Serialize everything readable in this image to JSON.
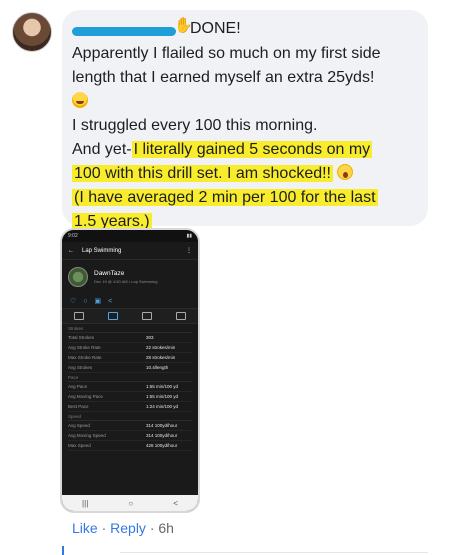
{
  "comment": {
    "tag": "DONE!",
    "lines": [
      "Apparently I flailed so much on my first side",
      "length that I earned myself an extra 25yds!"
    ],
    "line_struggled": "I struggled every 100 this morning.",
    "line_andyet_prefix": "And yet-",
    "line_andyet_highlight": "I literally gained 5 seconds on my",
    "line_100_highlight": "100 with this drill set. I am shocked!!",
    "line_averaged_highlight": "(I have averaged 2 min per 100 for the last",
    "line_years_highlight": "1.5 years.)"
  },
  "phone": {
    "time": "9:02",
    "title": "Lap Swimming",
    "profile_name": "DawnTaze",
    "profile_sub": "Dec 19 @ 4:50 AM • Lap Swimming",
    "sections": [
      {
        "name": "Strokes",
        "rows": [
          {
            "label": "Total Strokes",
            "value": "303"
          },
          {
            "label": "Avg Stroke Rate",
            "value": "22 strokes/min"
          },
          {
            "label": "Max Stroke Rate",
            "value": "28 strokes/min"
          },
          {
            "label": "Avg Strokes",
            "value": "10.4/length"
          }
        ]
      },
      {
        "name": "Pace",
        "rows": [
          {
            "label": "Avg Pace",
            "value": "1:55 min/100 yd"
          },
          {
            "label": "Avg Moving Pace",
            "value": "1:55 min/100 yd"
          },
          {
            "label": "Best Pace",
            "value": "1:24 min/100 yd"
          }
        ]
      },
      {
        "name": "Speed",
        "rows": [
          {
            "label": "Avg Speed",
            "value": "314 100yd/hour"
          },
          {
            "label": "Avg Moving Speed",
            "value": "314 100yd/hour"
          },
          {
            "label": "Max Speed",
            "value": "426 100yd/hour"
          }
        ]
      }
    ]
  },
  "footer": {
    "like": "Like",
    "dot": "·",
    "reply": "Reply",
    "time": "6h"
  },
  "colors": {
    "highlight": "#f8ec2c",
    "link": "#3578e5",
    "redaction": "#1e9fd8"
  },
  "icons": [
    "wave-icon",
    "laughing-emoji-icon",
    "shocked-emoji-icon",
    "back-arrow-icon",
    "more-icon",
    "heart-icon",
    "comment-icon",
    "share-icon"
  ]
}
